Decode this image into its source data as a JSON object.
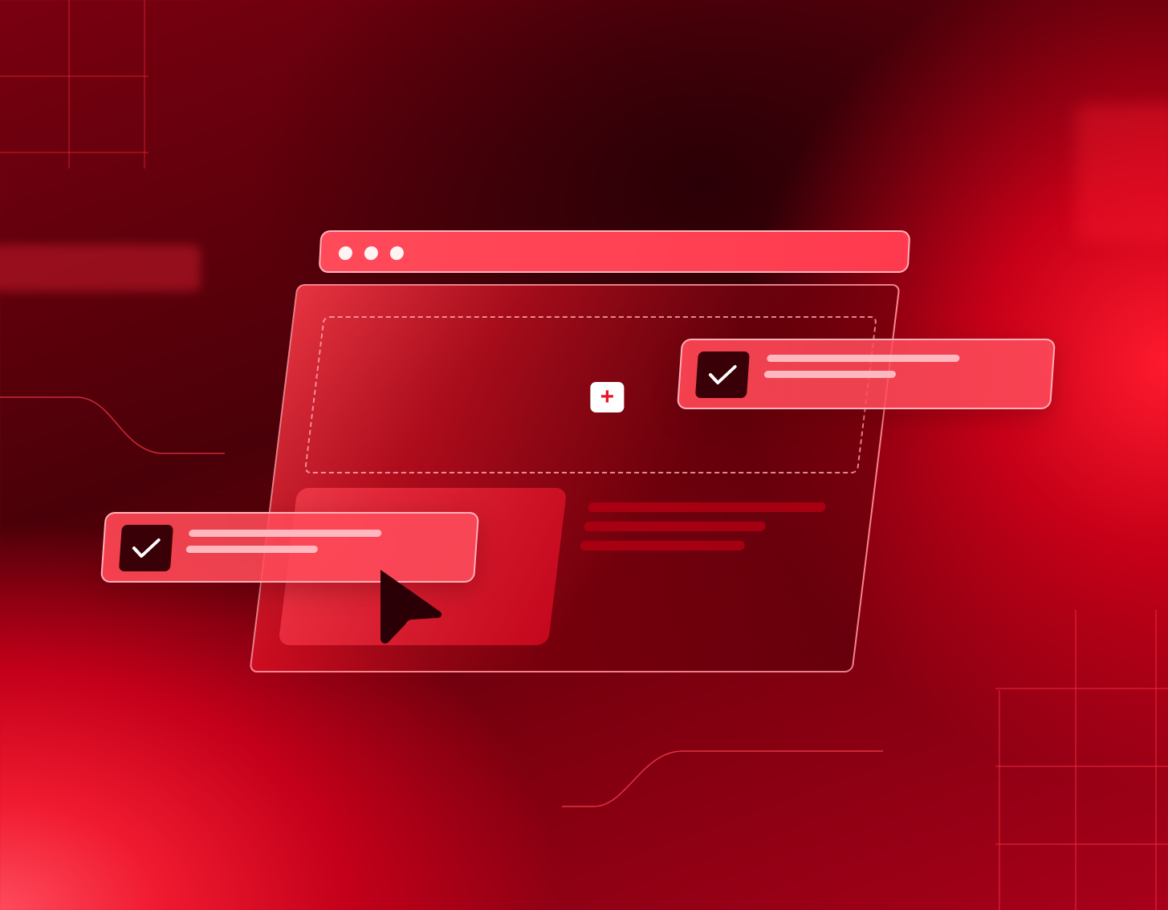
{
  "illustration": {
    "theme": "red",
    "colors": {
      "background_dark": "#4a0008",
      "background_bright": "#f01a30",
      "accent": "#ff3a4e",
      "card_fill": "#ff4a5a",
      "checkbox_fill": "#3a0008",
      "check_mark": "#ffffff",
      "cursor": "#2a0006"
    },
    "browser": {
      "window_dots": [
        "dot",
        "dot",
        "dot"
      ],
      "add_icon": "plus-icon"
    },
    "task_cards": [
      {
        "icon": "check-icon",
        "checked": true
      },
      {
        "icon": "check-icon",
        "checked": true
      }
    ],
    "pointer_icon": "cursor-arrow-icon"
  }
}
